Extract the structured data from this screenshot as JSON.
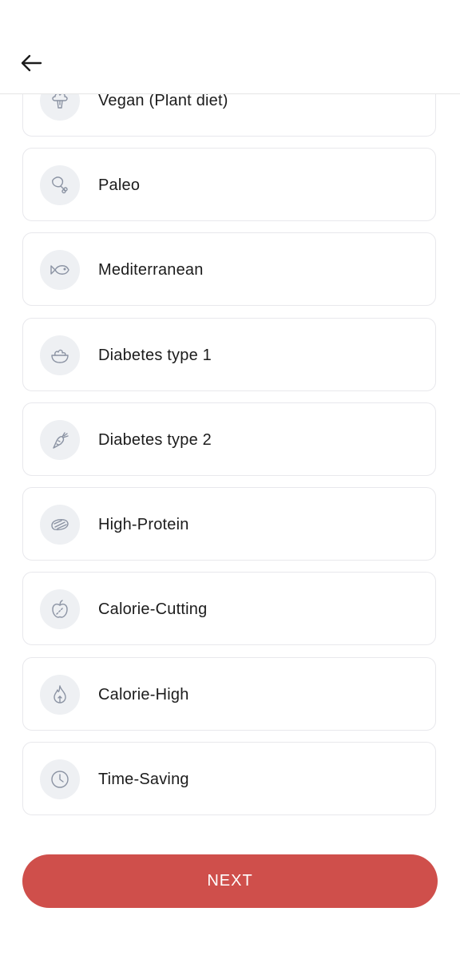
{
  "header": {
    "back_icon": "arrow-left-icon"
  },
  "diet_options": [
    {
      "label": "Vegan (Plant diet)",
      "icon": "broccoli-icon"
    },
    {
      "label": "Paleo",
      "icon": "drumstick-icon"
    },
    {
      "label": "Mediterranean",
      "icon": "fish-icon"
    },
    {
      "label": "Diabetes type 1",
      "icon": "salad-bowl-icon"
    },
    {
      "label": "Diabetes type 2",
      "icon": "carrot-icon"
    },
    {
      "label": "High-Protein",
      "icon": "steak-icon"
    },
    {
      "label": "Calorie-Cutting",
      "icon": "apple-icon"
    },
    {
      "label": "Calorie-High",
      "icon": "flame-icon"
    },
    {
      "label": "Time-Saving",
      "icon": "clock-icon"
    }
  ],
  "next_button": {
    "label": "NEXT"
  },
  "colors": {
    "accent": "#cf4f4b",
    "icon_bg": "#eef0f3",
    "icon_stroke": "#8b93a3"
  }
}
